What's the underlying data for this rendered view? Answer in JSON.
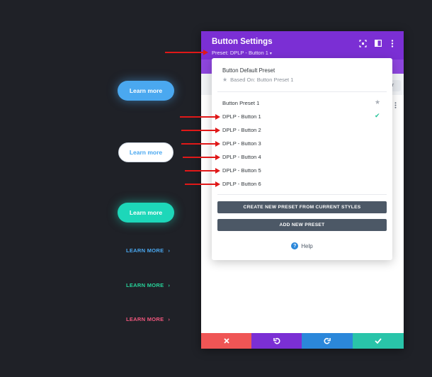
{
  "preview": {
    "pill_blue": "Learn more",
    "pill_white": "Learn more",
    "pill_teal": "Learn more",
    "link_blue": "LEARN MORE",
    "link_green": "LEARN MORE",
    "link_pink": "LEARN MORE",
    "chevron": "›"
  },
  "panel": {
    "title": "Button Settings",
    "preset_label": "Preset: DPLP - Button 1",
    "preset_caret": "▾",
    "icons": [
      "focus-icon",
      "sidebar-toggle-icon",
      "more-vertical-icon"
    ],
    "filter_chip": "er"
  },
  "dropdown": {
    "default_title": "Button Default Preset",
    "based_on": "Based On: Button Preset 1",
    "items": [
      "Button Preset 1",
      "DPLP - Button 1",
      "DPLP - Button 2",
      "DPLP - Button 3",
      "DPLP - Button 4",
      "DPLP - Button 5",
      "DPLP - Button 6"
    ],
    "create_button": "CREATE NEW PRESET FROM CURRENT STYLES",
    "add_button": "ADD NEW PRESET",
    "help": "Help"
  },
  "footer": {
    "icons": [
      "close-icon",
      "undo-icon",
      "redo-icon",
      "check-icon"
    ]
  },
  "colors": {
    "header_purple": "#7b2fd4",
    "cancel_red": "#ef5555",
    "redo_blue": "#2b87da",
    "save_teal": "#29c4a9",
    "arrow_red": "#e01818"
  }
}
